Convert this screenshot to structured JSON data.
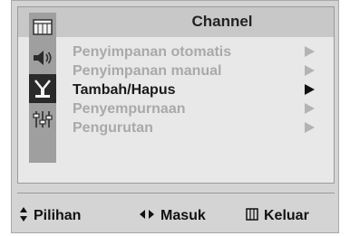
{
  "menu": {
    "title": "Channel",
    "icons": [
      {
        "name": "picture-icon",
        "active": false
      },
      {
        "name": "sound-icon",
        "active": false
      },
      {
        "name": "channel-antenna-icon",
        "active": true
      },
      {
        "name": "setup-icon",
        "active": false
      }
    ],
    "items": [
      {
        "label": "Penyimpanan otomatis",
        "active": false
      },
      {
        "label": "Penyimpanan manual",
        "active": false
      },
      {
        "label": "Tambah/Hapus",
        "active": true
      },
      {
        "label": "Penyempurnaan",
        "active": false
      },
      {
        "label": "Pengurutan",
        "active": false
      }
    ]
  },
  "footer": {
    "move_label": "Pilihan",
    "enter_label": "Masuk",
    "exit_label": "Keluar"
  }
}
